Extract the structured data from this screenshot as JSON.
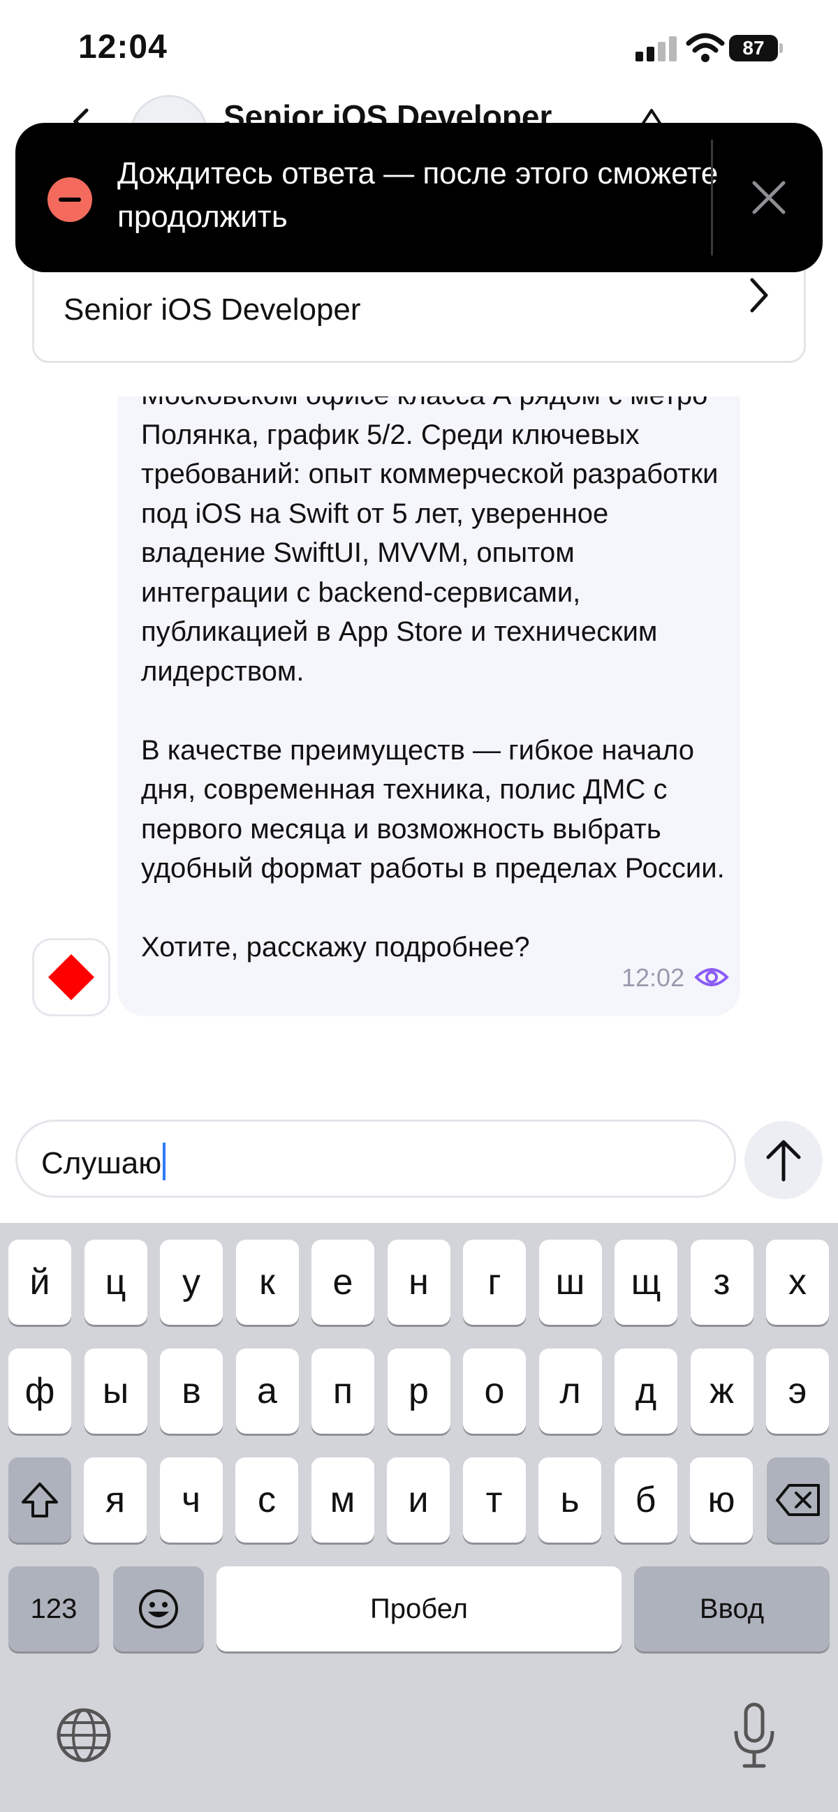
{
  "status_bar": {
    "time": "12:04",
    "battery": "87"
  },
  "header": {
    "title": "Senior iOS Developer"
  },
  "vacancy_card": {
    "title": "Senior iOS Developer"
  },
  "toast": {
    "text": "Дождитесь ответа — после этого сможете продолжить"
  },
  "message": {
    "text": "Московском офисе класса А рядом с метро Полянка, график 5/2. Среди ключевых требований: опыт коммерческой разработки под iOS на Swift от 5 лет, уверенное владение SwiftUI, MVVM, опытом интеграции с backend-сервисами, публикацией в App Store и техническим лидерством.\n\nВ качестве преимуществ — гибкое начало дня, современная техника, полис ДМС с первого месяца и возможность выбрать удобный формат работы в пределах России.\n\nХотите, расскажу подробнее?",
    "time": "12:02"
  },
  "input": {
    "value": "Слушаю"
  },
  "keyboard": {
    "row1": [
      "й",
      "ц",
      "у",
      "к",
      "е",
      "н",
      "г",
      "ш",
      "щ",
      "з",
      "х"
    ],
    "row2": [
      "ф",
      "ы",
      "в",
      "а",
      "п",
      "р",
      "о",
      "л",
      "д",
      "ж",
      "э"
    ],
    "row3": [
      "я",
      "ч",
      "с",
      "м",
      "и",
      "т",
      "ь",
      "б",
      "ю"
    ],
    "numbers_label": "123",
    "space_label": "Пробел",
    "return_label": "Ввод"
  },
  "colors": {
    "toast_background": "#000000",
    "toast_icon": "#f46b5d",
    "bubble": "#f5f5fc",
    "seen": "#8a5cf6",
    "bot_logo": "#ff0000"
  }
}
